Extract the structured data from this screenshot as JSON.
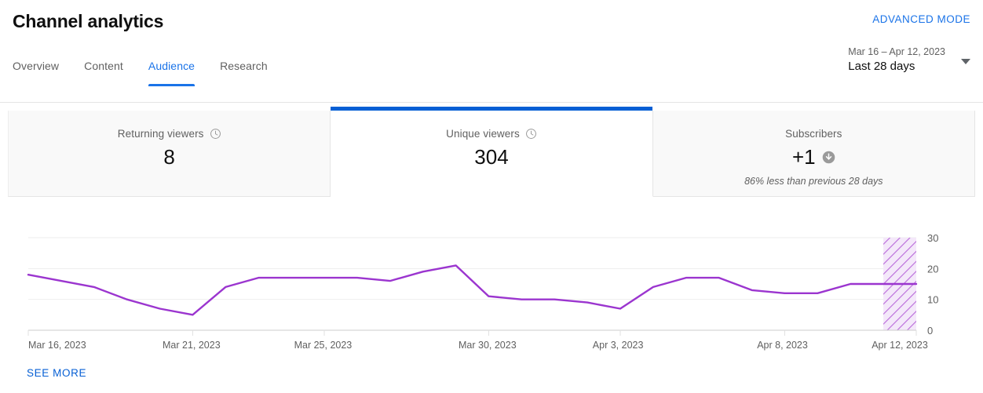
{
  "header": {
    "title": "Channel analytics",
    "advanced_mode_label": "ADVANCED MODE",
    "date_range": {
      "range": "Mar 16 – Apr 12, 2023",
      "preset": "Last 28 days",
      "caret_icon": "chevron-down-icon"
    },
    "tabs": [
      {
        "label": "Overview",
        "active": false
      },
      {
        "label": "Content",
        "active": false
      },
      {
        "label": "Audience",
        "active": true
      },
      {
        "label": "Research",
        "active": false
      }
    ]
  },
  "metric_cards": [
    {
      "label": "Returning viewers",
      "value": "8",
      "info_icon": "clock-icon",
      "delta": "",
      "trend_icon": "",
      "selected": false
    },
    {
      "label": "Unique viewers",
      "value": "304",
      "info_icon": "clock-icon",
      "delta": "",
      "trend_icon": "",
      "selected": true
    },
    {
      "label": "Subscribers",
      "value": "+1",
      "info_icon": "",
      "delta": "86% less than previous 28 days",
      "trend_icon": "arrow-down-circle-icon",
      "selected": false
    }
  ],
  "footer": {
    "see_more_label": "SEE MORE"
  },
  "colors": {
    "accent_blue": "#065fd4",
    "link_blue": "#1a73e8",
    "series_purple": "#9b35cf",
    "card_background": "#f9f9f9",
    "gridline": "#eeeeee"
  },
  "chart_data": {
    "type": "line",
    "title": "",
    "xlabel": "",
    "ylabel": "",
    "ylim": [
      0,
      30
    ],
    "y_ticks": [
      0,
      10,
      20,
      30
    ],
    "grid": true,
    "legend": "none",
    "series_name": "Unique viewers",
    "series_color": "#9b35cf",
    "x_tick_labels": [
      "Mar 16, 2023",
      "Mar 21, 2023",
      "Mar 25, 2023",
      "Mar 30, 2023",
      "Apr 3, 2023",
      "Apr 8, 2023",
      "Apr 12, 2023"
    ],
    "x_tick_indices": [
      0,
      5,
      9,
      14,
      18,
      23,
      27
    ],
    "partial_data_region": {
      "from_index": 26,
      "to_index": 27,
      "style": "diagonal-hatch"
    },
    "x": [
      "Mar 16, 2023",
      "Mar 17, 2023",
      "Mar 18, 2023",
      "Mar 19, 2023",
      "Mar 20, 2023",
      "Mar 21, 2023",
      "Mar 22, 2023",
      "Mar 23, 2023",
      "Mar 24, 2023",
      "Mar 25, 2023",
      "Mar 26, 2023",
      "Mar 27, 2023",
      "Mar 28, 2023",
      "Mar 29, 2023",
      "Mar 30, 2023",
      "Mar 31, 2023",
      "Apr 1, 2023",
      "Apr 2, 2023",
      "Apr 3, 2023",
      "Apr 4, 2023",
      "Apr 5, 2023",
      "Apr 6, 2023",
      "Apr 7, 2023",
      "Apr 8, 2023",
      "Apr 9, 2023",
      "Apr 10, 2023",
      "Apr 11, 2023",
      "Apr 12, 2023"
    ],
    "values": [
      18,
      16,
      14,
      10,
      7,
      5,
      14,
      17,
      17,
      17,
      17,
      16,
      19,
      21,
      11,
      10,
      10,
      9,
      7,
      14,
      17,
      17,
      13,
      12,
      12,
      15,
      15,
      15
    ]
  }
}
